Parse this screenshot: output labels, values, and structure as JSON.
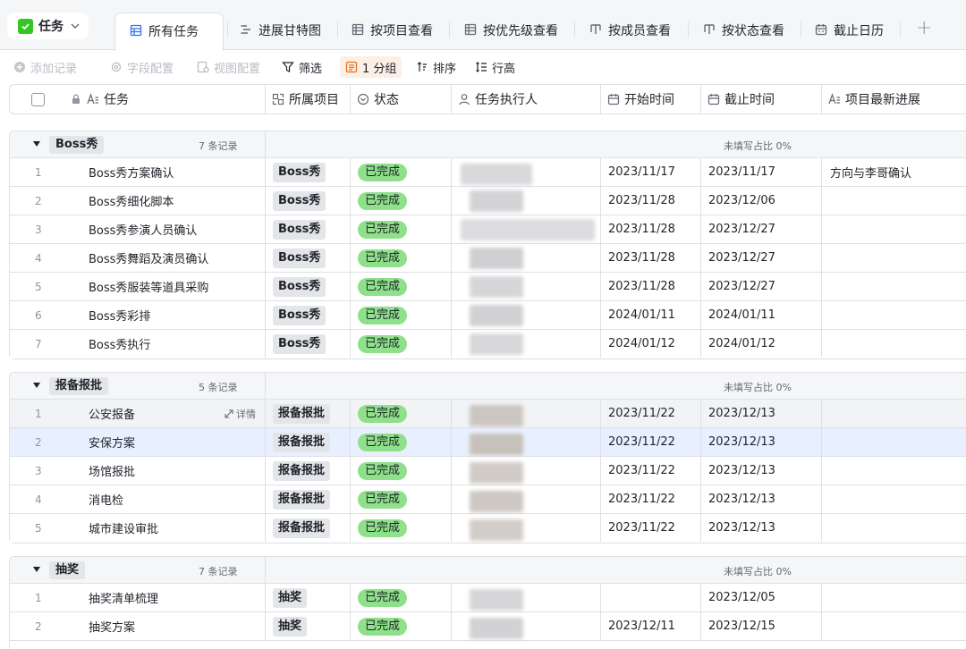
{
  "table": {
    "name": "任务"
  },
  "tabs": [
    {
      "label": "所有任务",
      "icon": "grid-view-icon",
      "active": true
    },
    {
      "label": "进展甘特图",
      "icon": "gantt-icon"
    },
    {
      "label": "按项目查看",
      "icon": "table-view-icon"
    },
    {
      "label": "按优先级查看",
      "icon": "table-view-icon"
    },
    {
      "label": "按成员查看",
      "icon": "kanban-icon"
    },
    {
      "label": "按状态查看",
      "icon": "kanban-icon"
    },
    {
      "label": "截止日历",
      "icon": "calendar-icon"
    }
  ],
  "toolbar": {
    "add_record": "添加记录",
    "field_config": "字段配置",
    "view_config": "视图配置",
    "filter": "筛选",
    "group": "1 分组",
    "sort": "排序",
    "row_height": "行高"
  },
  "columns": {
    "task": "任务",
    "project": "所属项目",
    "status": "状态",
    "executor": "任务执行人",
    "start": "开始时间",
    "end": "截止时间",
    "progress": "项目最新进展"
  },
  "groups": [
    {
      "name": "Boss秀",
      "count_label": "7 条记录",
      "fill_label": "未填写占比 0%",
      "rows": [
        {
          "num": "1",
          "task": "Boss秀方案确认",
          "project": "Boss秀",
          "status": "已完成",
          "start": "2023/11/17",
          "end": "2023/11/17",
          "progress": "方向与李哥确认"
        },
        {
          "num": "2",
          "task": "Boss秀细化脚本",
          "project": "Boss秀",
          "status": "已完成",
          "start": "2023/11/28",
          "end": "2023/12/06",
          "progress": ""
        },
        {
          "num": "3",
          "task": "Boss秀参演人员确认",
          "project": "Boss秀",
          "status": "已完成",
          "start": "2023/11/28",
          "end": "2023/12/27",
          "progress": ""
        },
        {
          "num": "4",
          "task": "Boss秀舞蹈及演员确认",
          "project": "Boss秀",
          "status": "已完成",
          "start": "2023/11/28",
          "end": "2023/12/27",
          "progress": ""
        },
        {
          "num": "5",
          "task": "Boss秀服装等道具采购",
          "project": "Boss秀",
          "status": "已完成",
          "start": "2023/11/28",
          "end": "2023/12/27",
          "progress": ""
        },
        {
          "num": "6",
          "task": "Boss秀彩排",
          "project": "Boss秀",
          "status": "已完成",
          "start": "2024/01/11",
          "end": "2024/01/11",
          "progress": ""
        },
        {
          "num": "7",
          "task": "Boss秀执行",
          "project": "Boss秀",
          "status": "已完成",
          "start": "2024/01/12",
          "end": "2024/01/12",
          "progress": ""
        }
      ]
    },
    {
      "name": "报备报批",
      "count_label": "5 条记录",
      "fill_label": "未填写占比 0%",
      "rows": [
        {
          "num": "1",
          "task": "公安报备",
          "project": "报备报批",
          "status": "已完成",
          "start": "2023/11/22",
          "end": "2023/12/13",
          "progress": "",
          "detail": "详情"
        },
        {
          "num": "2",
          "task": "安保方案",
          "project": "报备报批",
          "status": "已完成",
          "start": "2023/11/22",
          "end": "2023/12/13",
          "progress": ""
        },
        {
          "num": "3",
          "task": "场馆报批",
          "project": "报备报批",
          "status": "已完成",
          "start": "2023/11/22",
          "end": "2023/12/13",
          "progress": ""
        },
        {
          "num": "4",
          "task": "消电检",
          "project": "报备报批",
          "status": "已完成",
          "start": "2023/11/22",
          "end": "2023/12/13",
          "progress": ""
        },
        {
          "num": "5",
          "task": "城市建设审批",
          "project": "报备报批",
          "status": "已完成",
          "start": "2023/11/22",
          "end": "2023/12/13",
          "progress": ""
        }
      ]
    },
    {
      "name": "抽奖",
      "count_label": "7 条记录",
      "fill_label": "未填写占比 0%",
      "rows": [
        {
          "num": "1",
          "task": "抽奖清单梳理",
          "project": "抽奖",
          "status": "已完成",
          "start": "",
          "end": "2023/12/05",
          "progress": ""
        },
        {
          "num": "2",
          "task": "抽奖方案",
          "project": "抽奖",
          "status": "已完成",
          "start": "2023/12/11",
          "end": "2023/12/15",
          "progress": ""
        }
      ]
    }
  ],
  "colors": {
    "status_done": "#8ee08a",
    "accent": "#3370ff",
    "group_tag": "#e3e5e8"
  }
}
